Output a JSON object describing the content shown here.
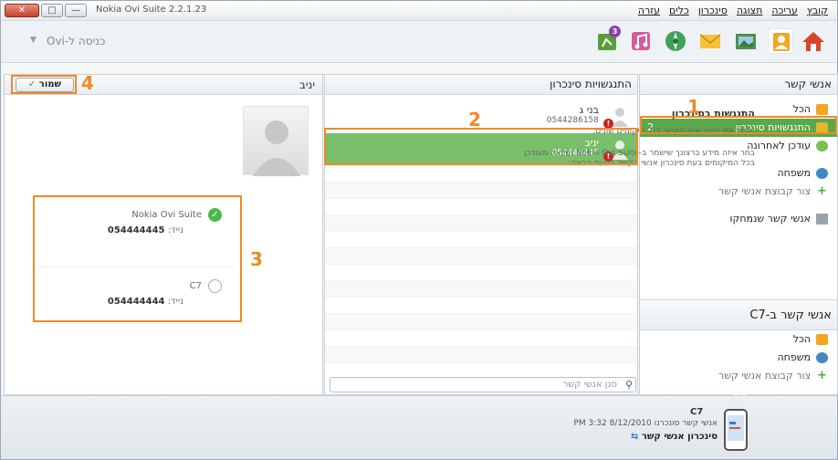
{
  "window": {
    "title": "Nokia Ovi Suite 2.2.1.23",
    "close_label": "✕",
    "max_label": "□",
    "min_label": "—"
  },
  "menu": [
    "קובץ",
    "עריכה",
    "תצוגה",
    "סינכרון",
    "כלים",
    "עזרה"
  ],
  "toolbar": {
    "store_link": "כניסה ל-Ovi",
    "icons": [
      "home-icon",
      "contacts-icon",
      "photos-icon",
      "messages-icon",
      "maps-icon",
      "music-icon",
      "apps-icon"
    ],
    "apps_badge": "3"
  },
  "nav": {
    "header": "אנשי קשר",
    "items": [
      {
        "label": "הכל",
        "icon": "folder-icon"
      },
      {
        "label": "התנגשויות סינכרון",
        "count": "2",
        "icon": "conflict-icon",
        "selected": true
      },
      {
        "label": "עודכן לאחרונה",
        "icon": "clock-icon"
      },
      {
        "label": "משפחה",
        "icon": "group-icon"
      },
      {
        "label": "צור קבוצת אנשי קשר",
        "icon": "plus-icon"
      },
      {
        "label": "אנשי קשר שנמחקו",
        "icon": "trash-icon"
      }
    ],
    "device_header": "אנשי קשר ב-C7",
    "device_items": [
      {
        "label": "הכל",
        "icon": "folder-icon"
      },
      {
        "label": "משפחה",
        "icon": "group-icon"
      },
      {
        "label": "צור קבוצת אנשי קשר",
        "icon": "plus-icon"
      }
    ]
  },
  "middle": {
    "header": "התנגשויות סינכרון",
    "contacts": [
      {
        "name": "בני ג",
        "phone": "0544286158"
      },
      {
        "name": "יניב",
        "phone": "054444445",
        "selected": true
      }
    ],
    "search_placeholder": "סנן אנשי קשר"
  },
  "detail": {
    "name": "יניב",
    "save_label": "שמור",
    "save_check": "✓",
    "conflict_title": "התנגשות בסינכרון",
    "conflict_desc": "שונית את פרטי איש הקשר ב-2 מיקומים שונים.",
    "conflict_help": "בחר איזה מידע ברצונך שישמר ב-Nokia Ovi Suite ושיהיה מעודכן בכל המיקומים בעת סינכרון אנשי הקשר בפעם הבאה:",
    "options": [
      {
        "source": "Nokia Ovi Suite",
        "phone_label": "נייד:",
        "phone": "054444445",
        "checked": true
      },
      {
        "source": "C7",
        "phone_label": "נייד:",
        "phone": "054444444",
        "checked": false
      }
    ]
  },
  "annotations": [
    "1",
    "2",
    "3",
    "4"
  ],
  "status": {
    "device_model": "C7",
    "sync_info": "אנשי קשר סונכרנו 8/12/2010 3:32 PM",
    "action": "סינכרון אנשי קשר"
  },
  "colors": {
    "selected_green": "#5aa84a",
    "annotation_orange": "#f08a24",
    "warning_red": "#cc2222"
  }
}
